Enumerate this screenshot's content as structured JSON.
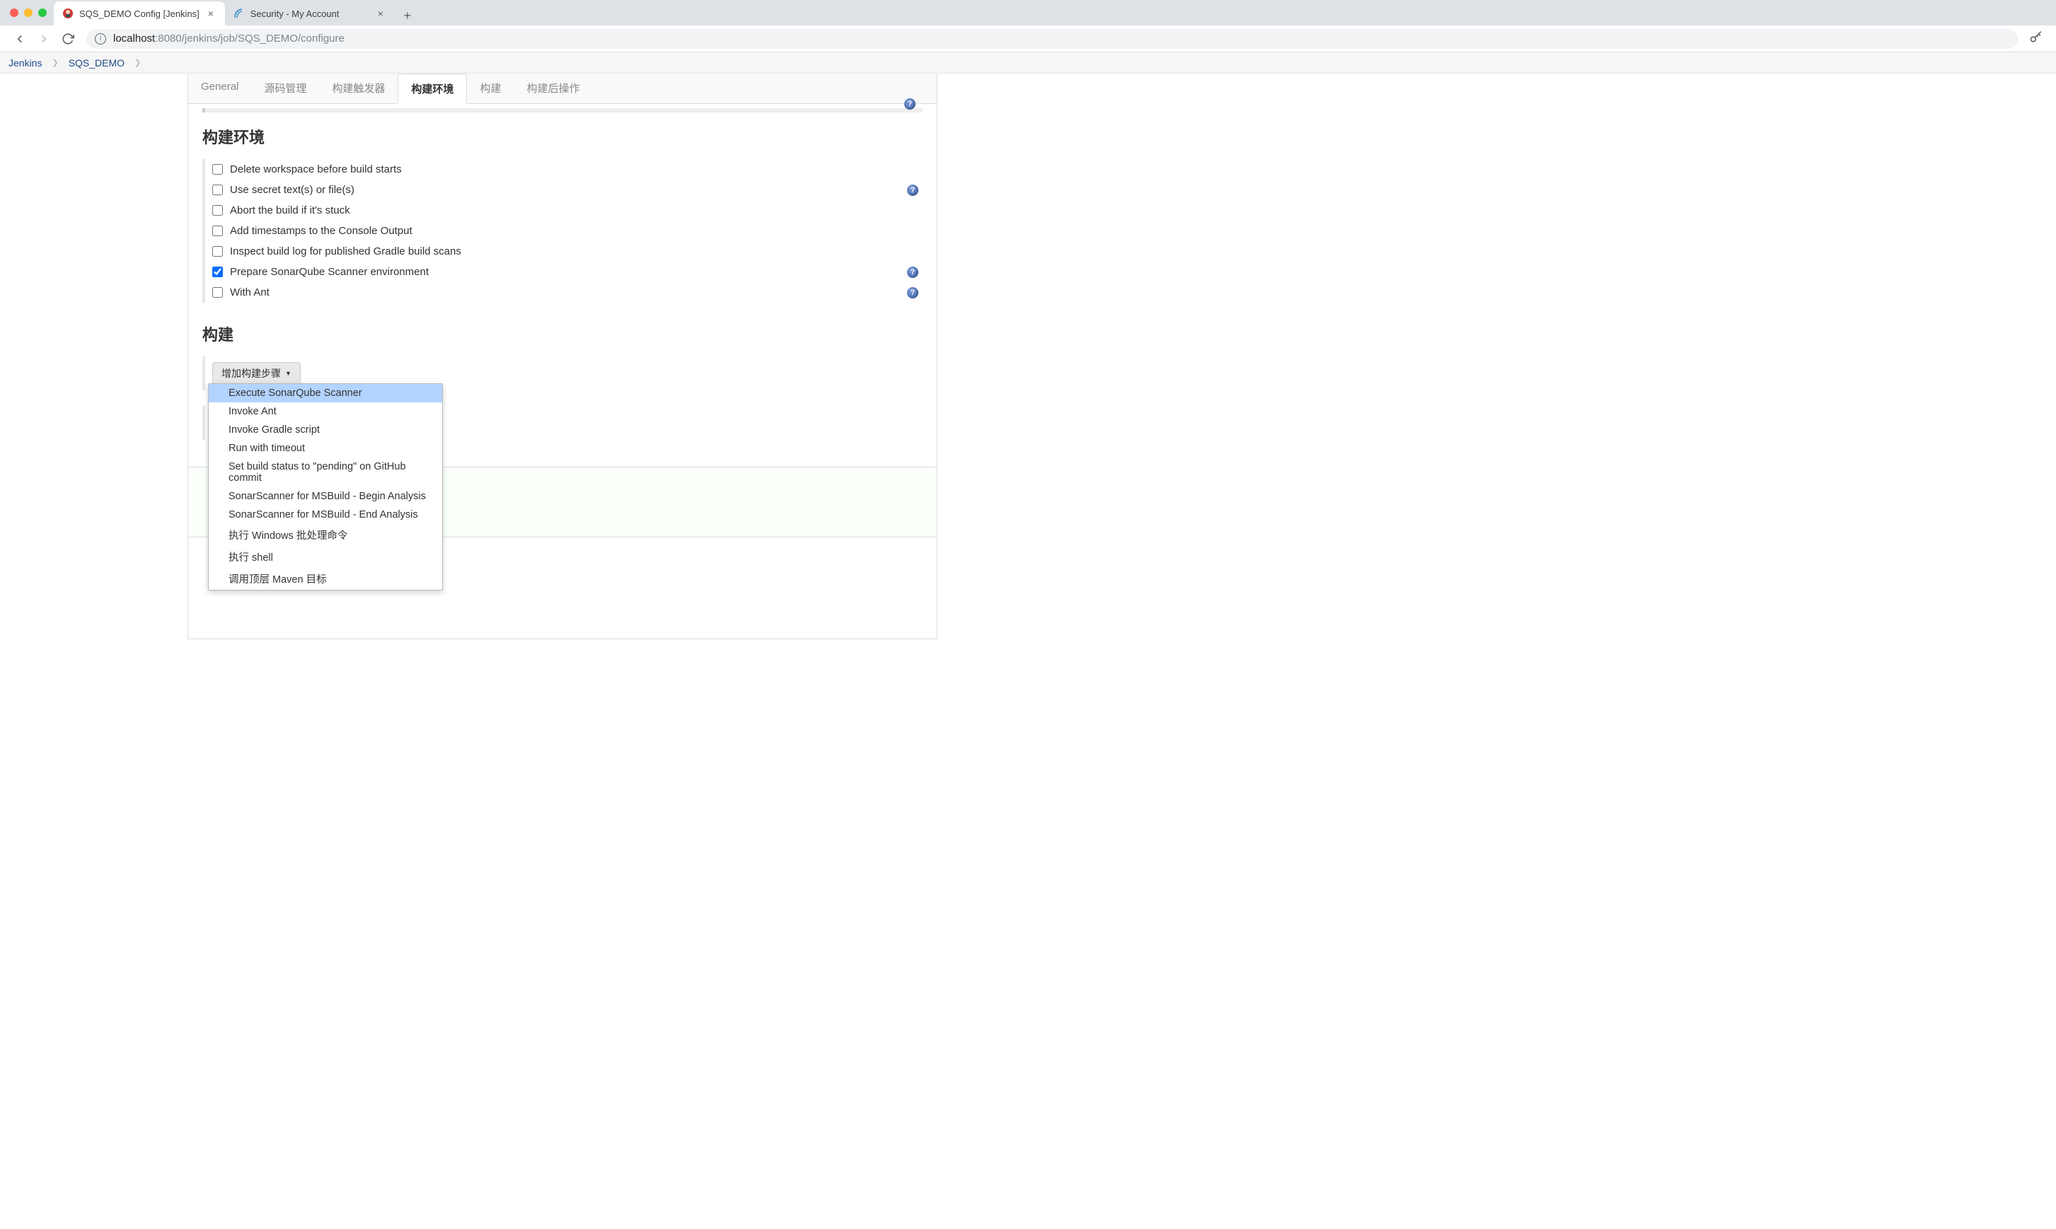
{
  "browser": {
    "tabs": [
      {
        "title": "SQS_DEMO Config [Jenkins]",
        "active": true
      },
      {
        "title": "Security - My Account",
        "active": false
      }
    ],
    "url": {
      "host": "localhost",
      "path": ":8080/jenkins/job/SQS_DEMO/configure"
    }
  },
  "breadcrumb": [
    "Jenkins",
    "SQS_DEMO"
  ],
  "config_tabs": [
    "General",
    "源码管理",
    "构建触发器",
    "构建环境",
    "构建",
    "构建后操作"
  ],
  "active_config_tab": 3,
  "sections": {
    "build_env": {
      "title": "构建环境",
      "options": [
        {
          "label": "Delete workspace before build starts",
          "checked": false,
          "help": false
        },
        {
          "label": "Use secret text(s) or file(s)",
          "checked": false,
          "help": true
        },
        {
          "label": "Abort the build if it's stuck",
          "checked": false,
          "help": false
        },
        {
          "label": "Add timestamps to the Console Output",
          "checked": false,
          "help": false
        },
        {
          "label": "Inspect build log for published Gradle build scans",
          "checked": false,
          "help": false
        },
        {
          "label": "Prepare SonarQube Scanner environment",
          "checked": true,
          "help": true
        },
        {
          "label": "With Ant",
          "checked": false,
          "help": true
        }
      ]
    },
    "build": {
      "title": "构建",
      "add_button": "增加构建步骤",
      "dropdown": [
        "Execute SonarQube Scanner",
        "Invoke Ant",
        "Invoke Gradle script",
        "Run with timeout",
        "Set build status to \"pending\" on GitHub commit",
        "SonarScanner for MSBuild - Begin Analysis",
        "SonarScanner for MSBuild - End Analysis",
        "执行 Windows 批处理命令",
        "执行 shell",
        "调用顶层 Maven 目标"
      ],
      "highlighted_index": 0
    }
  }
}
